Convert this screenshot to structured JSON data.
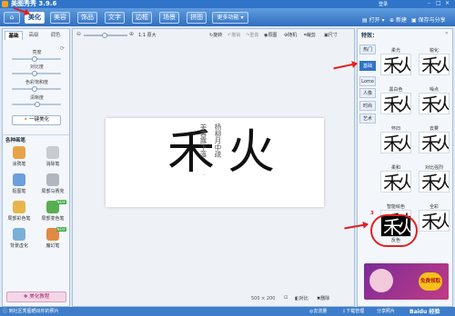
{
  "app": {
    "title": "美图秀秀 3.9.6"
  },
  "header": {
    "tabs": [
      {
        "label": "美化",
        "active": true
      },
      {
        "label": "美容"
      },
      {
        "label": "饰品"
      },
      {
        "label": "文字"
      },
      {
        "label": "边框"
      },
      {
        "label": "场景"
      },
      {
        "label": "拼图"
      },
      {
        "label": "更多功能"
      }
    ],
    "login_label": "登录",
    "open_label": "打开",
    "new_label": "新建",
    "save_share_label": "保存与分享"
  },
  "left_panel": {
    "tabs": [
      "基础",
      "高级",
      "调色"
    ],
    "sliders": [
      {
        "label": "亮度",
        "value": 0.45
      },
      {
        "label": "对比度",
        "value": 0.45
      },
      {
        "label": "色彩饱和度",
        "value": 0.45
      },
      {
        "label": "清晰度",
        "value": 0.5
      }
    ],
    "one_click_label": "一键美化",
    "brush_section_title": "各种画笔",
    "tools": [
      {
        "label": "涂鸦笔",
        "new": false,
        "color": "#e8a34a"
      },
      {
        "label": "消除笔",
        "new": false,
        "color": "#c8ccd2"
      },
      {
        "label": "抠图笔",
        "new": false,
        "color": "#6a9fdc"
      },
      {
        "label": "局部马赛克",
        "new": false,
        "color": "#b1b7bf"
      },
      {
        "label": "局部彩色笔",
        "new": false,
        "color": "#e6b64a"
      },
      {
        "label": "局部变色笔",
        "new": true,
        "color": "#5aae52"
      },
      {
        "label": "背景虚化",
        "new": false,
        "color": "#7ab0d8"
      },
      {
        "label": "魔幻笔",
        "new": true,
        "color": "#e28a44"
      }
    ],
    "beauty_label": "美化教程"
  },
  "canvas": {
    "toolbar": {
      "zoom_label": "1:1 原大",
      "rotate_label": "旋转",
      "undo_label": "撤销",
      "redo_label": "重做",
      "original_label": "原图",
      "crop_label": "裁剪",
      "resize_label": "尺寸",
      "smart_label": "随机"
    },
    "image": {
      "big_char_1": "禾",
      "big_char_2": "火",
      "col1": "芙蓉露下落",
      "col2": "杨柳月中疏",
      "dot": "·"
    },
    "footer": {
      "size_label": "500 × 200",
      "compare_label": "对比",
      "delete_label": "删除"
    }
  },
  "right_panel": {
    "title": "特效：",
    "categories": [
      {
        "label": "热门"
      },
      {
        "label": "基础",
        "active": true
      },
      {
        "label": "Lomo"
      },
      {
        "label": "人像"
      },
      {
        "label": "时尚"
      },
      {
        "label": "艺术"
      }
    ],
    "effects": [
      {
        "label": "柔光"
      },
      {
        "label": "锐化"
      },
      {
        "label": "黑白色"
      },
      {
        "label": "噪点"
      },
      {
        "label": "怀旧"
      },
      {
        "label": "去雾"
      },
      {
        "label": "柔和"
      },
      {
        "label": "对比强烈"
      },
      {
        "label": "智能绘色"
      },
      {
        "label": "全彩"
      },
      {
        "label": "反色"
      }
    ],
    "step_number": "3",
    "ad_label": "免费领取"
  },
  "status_bar": {
    "tip": "到社区秀图晒出你的照片",
    "fast_label": "去流量",
    "download_label": "下载管理",
    "share_label": "分享照片",
    "watermark": "Baidu 经验"
  },
  "colors": {
    "title_bar": "#2f74c8",
    "accent_red": "#e02020",
    "active_blue": "#2f74c8"
  }
}
